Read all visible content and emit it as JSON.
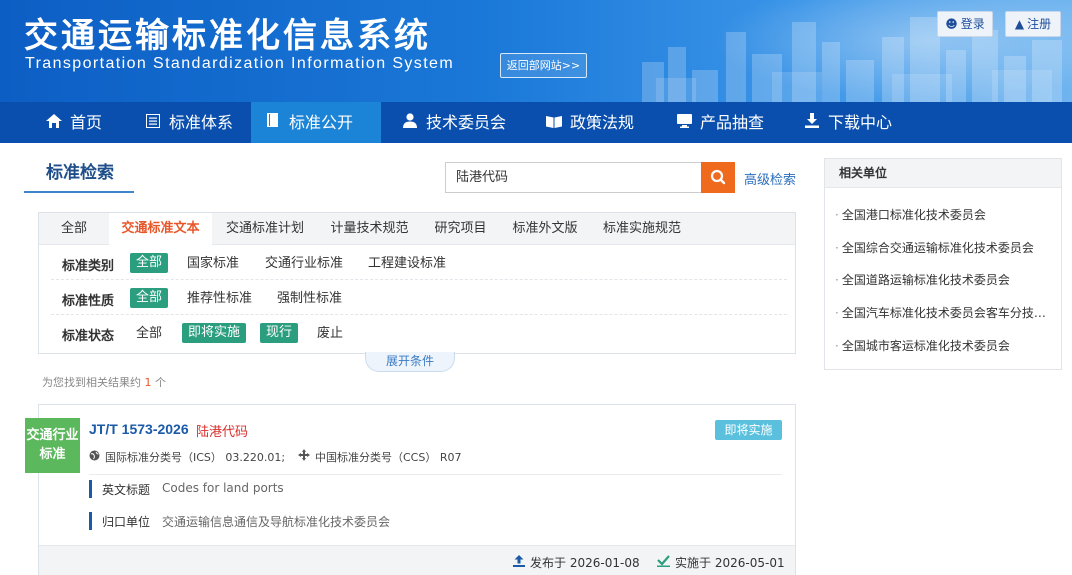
{
  "header": {
    "title": "交通运输标准化信息系统",
    "subtitle": "Transportation Standardization Information System",
    "back_link": "返回部网站>>",
    "login": "登录",
    "register": "注册"
  },
  "nav": {
    "items": [
      {
        "label": "首页",
        "icon": "home-icon"
      },
      {
        "label": "标准体系",
        "icon": "list-icon"
      },
      {
        "label": "标准公开",
        "icon": "book-icon",
        "active": true
      },
      {
        "label": "技术委员会",
        "icon": "user-icon"
      },
      {
        "label": "政策法规",
        "icon": "law-book-icon"
      },
      {
        "label": "产品抽查",
        "icon": "monitor-icon"
      },
      {
        "label": "下载中心",
        "icon": "download-icon"
      }
    ]
  },
  "search": {
    "title": "标准检索",
    "query": "陆港代码",
    "advanced": "高级检索"
  },
  "filter": {
    "tabs": [
      "全部",
      "交通标准文本",
      "交通标准计划",
      "计量技术规范",
      "研究项目",
      "标准外文版",
      "标准实施规范"
    ],
    "active_tab": "交通标准文本",
    "rows": [
      {
        "label": "标准类别",
        "options": [
          "全部",
          "国家标准",
          "交通行业标准",
          "工程建设标准"
        ]
      },
      {
        "label": "标准性质",
        "options": [
          "全部",
          "推荐性标准",
          "强制性标准"
        ]
      },
      {
        "label": "标准状态",
        "options": [
          "全部",
          "即将实施",
          "现行",
          "废止"
        ]
      }
    ],
    "expand": "展开条件"
  },
  "result_count": {
    "prefix": "为您找到相关结果约",
    "count": "1",
    "suffix": "个"
  },
  "result": {
    "category_line1": "交通行业",
    "category_line2": "标准",
    "code": "JT/T 1573-2026",
    "name": "陆港代码",
    "status": "即将实施",
    "ics_label": "国际标准分类号（ICS）",
    "ics_value": "03.220.01;",
    "ccs_label": "中国标准分类号（CCS）",
    "ccs_value": "R07",
    "english_label": "英文标题",
    "english_value": "Codes for land ports",
    "unit_label": "归口单位",
    "unit_value": "交通运输信息通信及导航标准化技术委员会",
    "published_label": "发布于",
    "published": "2026-01-08",
    "implemented_label": "实施于",
    "implemented": "2026-05-01"
  },
  "sidebar": {
    "title": "相关单位",
    "items": [
      "全国港口标准化技术委员会",
      "全国综合交通运输标准化技术委员会",
      "全国道路运输标准化技术委员会",
      "全国汽车标准化技术委员会客车分技术委员会",
      "全国城市客运标准化技术委员会"
    ]
  },
  "colors": {
    "nav_bg": "#0a4fae",
    "nav_active": "#1c84d6",
    "accent_orange": "#e8572a",
    "tag_green": "#2a9e7e",
    "badge_green": "#5cb85c",
    "status_blue": "#5bc0de"
  }
}
